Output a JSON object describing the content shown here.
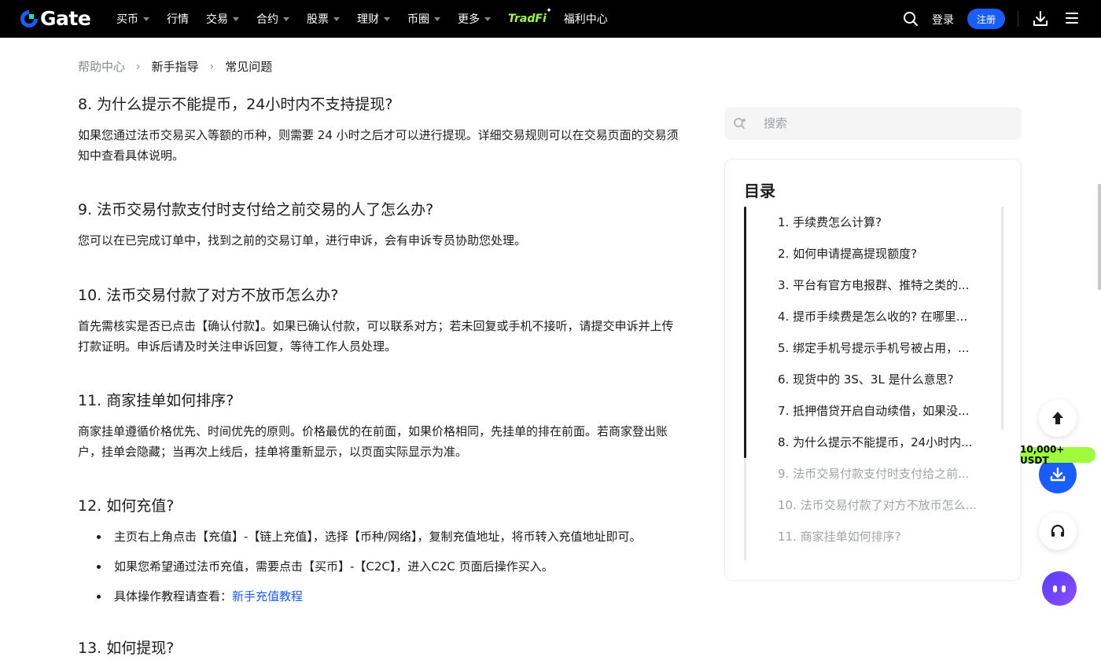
{
  "nav": {
    "logo_text": "Gate",
    "items": [
      {
        "label": "买币",
        "has_caret": true
      },
      {
        "label": "行情",
        "has_caret": false
      },
      {
        "label": "交易",
        "has_caret": true
      },
      {
        "label": "合约",
        "has_caret": true
      },
      {
        "label": "股票",
        "has_caret": true
      },
      {
        "label": "理财",
        "has_caret": true
      },
      {
        "label": "币圈",
        "has_caret": true
      },
      {
        "label": "更多",
        "has_caret": true
      }
    ],
    "tradfi_label": "TradFi",
    "welfare_label": "福利中心",
    "login_label": "登录",
    "register_label": "注册",
    "icons": [
      "search-icon",
      "download-icon",
      "menu-icon"
    ],
    "accent_color": "#1a5dfd",
    "tradfi_color": "#9dfa3c"
  },
  "breadcrumb": {
    "items": [
      "帮助中心",
      "新手指导",
      "常见问题"
    ]
  },
  "article": {
    "q8": "8. 为什么提示不能提币，24小时内不支持提现?",
    "a8": "如果您通过法币交易买入等额的币种，则需要 24 小时之后才可以进行提现。详细交易规则可以在交易页面的交易须知中查看具体说明。",
    "q9": "9. 法币交易付款支付时支付给之前交易的人了怎么办?",
    "a9": "您可以在已完成订单中，找到之前的交易订单，进行申诉，会有申诉专员协助您处理。",
    "q10": "10. 法币交易付款了对方不放币怎么办?",
    "a10": "首先需核实是否已点击【确认付款】。如果已确认付款，可以联系对方；若未回复或手机不接听，请提交申诉并上传打款证明。申诉后请及时关注申诉回复，等待工作人员处理。",
    "q11": "11. 商家挂单如何排序?",
    "a11": "商家挂单遵循价格优先、时间优先的原则。价格最优的在前面，如果价格相同，先挂单的排在前面。若商家登出账户，挂单会隐藏；当再次上线后，挂单将重新显示，以页面实际显示为准。",
    "q12": "12. 如何充值?",
    "a12_items": [
      "主页右上角点击【充值】-【链上充值】，选择【币种/网络】，复制充值地址，将币转入充值地址即可。",
      "如果您希望通过法币充值，需要点击【买币】-【C2C】，进入C2C 页面后操作买入。"
    ],
    "a12_tutorial_prefix": "具体操作教程请查看：",
    "a12_tutorial_link": "新手充值教程",
    "q13": "13. 如何提现?"
  },
  "sidebar": {
    "search_placeholder": "搜索",
    "toc_title": "目录",
    "toc_items": [
      {
        "label": "1. 手续费怎么计算?",
        "state": "read"
      },
      {
        "label": "2. 如何申请提高提现额度?",
        "state": "read"
      },
      {
        "label": "3. 平台有官方电报群、推特之类的...",
        "state": "read"
      },
      {
        "label": "4. 提币手续费是怎么收的? 在哪里...",
        "state": "read"
      },
      {
        "label": "5. 绑定手机号提示手机号被占用，...",
        "state": "read"
      },
      {
        "label": "6. 现货中的 3S、3L 是什么意思?",
        "state": "read"
      },
      {
        "label": "7. 抵押借贷开启自动续借，如果没...",
        "state": "read"
      },
      {
        "label": "8. 为什么提示不能提币，24小时内...",
        "state": "read"
      },
      {
        "label": "9. 法币交易付款支付时支付给之前...",
        "state": "unread"
      },
      {
        "label": "10. 法币交易付款了对方不放币怎么...",
        "state": "unread"
      },
      {
        "label": "11. 商家挂单如何排序?",
        "state": "unread"
      }
    ]
  },
  "floating": {
    "usdt_badge": "10,000+ USDT",
    "icons": [
      "arrow-up-icon",
      "download-icon",
      "headset-icon",
      "chatbot-icon"
    ]
  }
}
